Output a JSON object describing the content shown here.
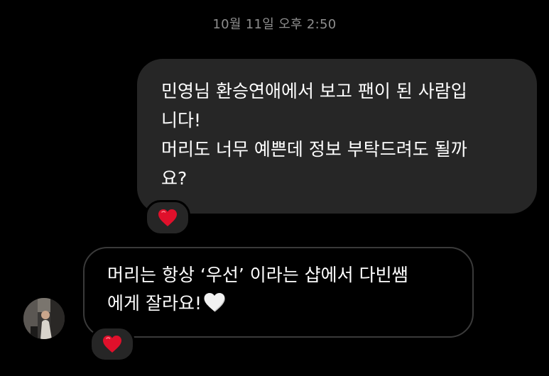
{
  "timestamp": "10월 11일 오후 2:50",
  "outgoing_message": {
    "line1": "민영님 환승연애에서 보고 팬이 된 사람입",
    "line2": "니다!",
    "line3": "머리도 너무 예쁜데 정보 부탁드려도 될까",
    "line4": "요?",
    "reaction_icon": "red-heart-icon"
  },
  "incoming_message": {
    "line1": "머리는 항상 ‘우선’ 이라는 샵에서 다빈쌤",
    "line2": "에게 잘라요!",
    "inline_icon": "white-heart-icon",
    "reaction_icon": "red-heart-icon",
    "avatar_icon": "profile-avatar"
  },
  "colors": {
    "background": "#000000",
    "outgoing_bubble": "#262626",
    "incoming_bubble_border": "#3a3a3a",
    "timestamp_text": "#8e8e8e",
    "reaction_heart": "#e0102b"
  }
}
